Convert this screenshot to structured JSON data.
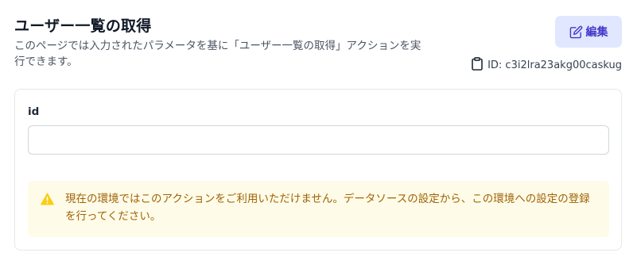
{
  "header": {
    "title": "ユーザー一覧の取得",
    "description": "このページでは入力されたパラメータを基に「ユーザー一覧の取得」アクションを実行できます。",
    "edit_label": "編集",
    "edit_icon": "pencil-square-icon",
    "id_icon": "clipboard-icon",
    "id_text": "ID: c3i2lra23akg00caskug"
  },
  "form": {
    "id_label": "id",
    "id_value": "",
    "id_placeholder": ""
  },
  "alert": {
    "icon": "warning-triangle-icon",
    "message": "現在の環境ではこのアクションをご利用いただけません。データソースの設定から、この環境への設定の登録を行ってください。"
  },
  "colors": {
    "accent": "#4338ca",
    "accent_bg": "#e0e7ff",
    "warning_bg": "#fefce8",
    "warning_text": "#a16207",
    "warning_icon": "#facc15"
  }
}
